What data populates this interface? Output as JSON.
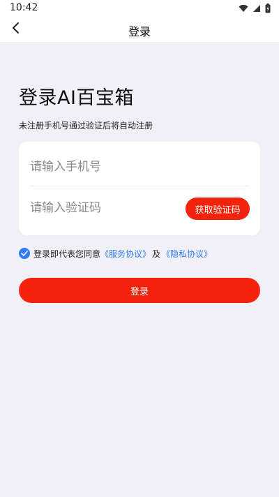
{
  "status_bar": {
    "time": "10:42",
    "icons": [
      "wifi-icon",
      "signal-icon",
      "battery-icon"
    ]
  },
  "app_bar": {
    "title": "登录",
    "back_icon": "chevron-left-icon"
  },
  "main": {
    "headline": "登录AI百宝箱",
    "subtitle": "未注册手机号通过验证后将自动注册",
    "form": {
      "phone_placeholder": "请输入手机号",
      "phone_value": "",
      "code_placeholder": "请输入验证码",
      "code_value": "",
      "get_code_label": "获取验证码"
    },
    "agreement": {
      "checked": true,
      "text": "登录即代表您同意",
      "service_link": "《服务协议》",
      "conjunction": "及",
      "privacy_link": "《隐私协议》"
    },
    "login_label": "登录"
  },
  "colors": {
    "accent": "#f2220d",
    "link": "#2f7cf6",
    "background": "#f1f0f6",
    "card": "#ffffff"
  }
}
